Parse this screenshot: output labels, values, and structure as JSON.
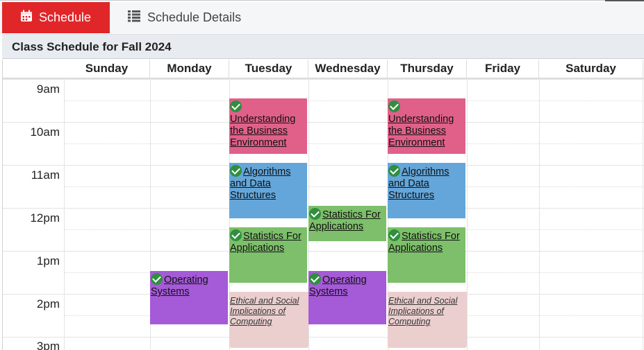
{
  "tabs": [
    {
      "label": "Schedule",
      "icon": "calendar-icon",
      "active": true
    },
    {
      "label": "Schedule Details",
      "icon": "list-icon",
      "active": false
    }
  ],
  "page_title": "Class Schedule for Fall 2024",
  "days": [
    "Sunday",
    "Monday",
    "Tuesday",
    "Wednesday",
    "Thursday",
    "Friday",
    "Saturday"
  ],
  "times": [
    "9am",
    "10am",
    "11am",
    "12pm",
    "1pm",
    "2pm",
    "3pm"
  ],
  "colors": {
    "active_tab": "#e1262a",
    "business": "#e0608a",
    "algorithms": "#64a6d9",
    "statistics": "#7dbf6a",
    "operating_systems": "#a55ad8",
    "ethics": "#ebcfcf",
    "check": "#2f8f3f"
  },
  "events": {
    "business_tue": {
      "label": "Understanding the Business Environment",
      "enrolled": true
    },
    "business_thu": {
      "label": "Understanding the Business Environment",
      "enrolled": true
    },
    "algo_tue": {
      "label": "Algorithms and Data Structures",
      "enrolled": true
    },
    "algo_thu": {
      "label": "Algorithms and Data Structures",
      "enrolled": true
    },
    "stats_wed": {
      "label": "Statistics For Applications",
      "enrolled": true
    },
    "stats_tue": {
      "label": "Statistics For Applications",
      "enrolled": true
    },
    "stats_thu": {
      "label": "Statistics For Applications",
      "enrolled": true
    },
    "os_mon": {
      "label": "Operating Systems",
      "enrolled": true
    },
    "os_wed": {
      "label": "Operating Systems",
      "enrolled": true
    },
    "ethics_tue": {
      "label": "Ethical and Social Implications of Computing",
      "enrolled": false
    },
    "ethics_thu": {
      "label": "Ethical and Social Implications of Computing",
      "enrolled": false
    }
  }
}
